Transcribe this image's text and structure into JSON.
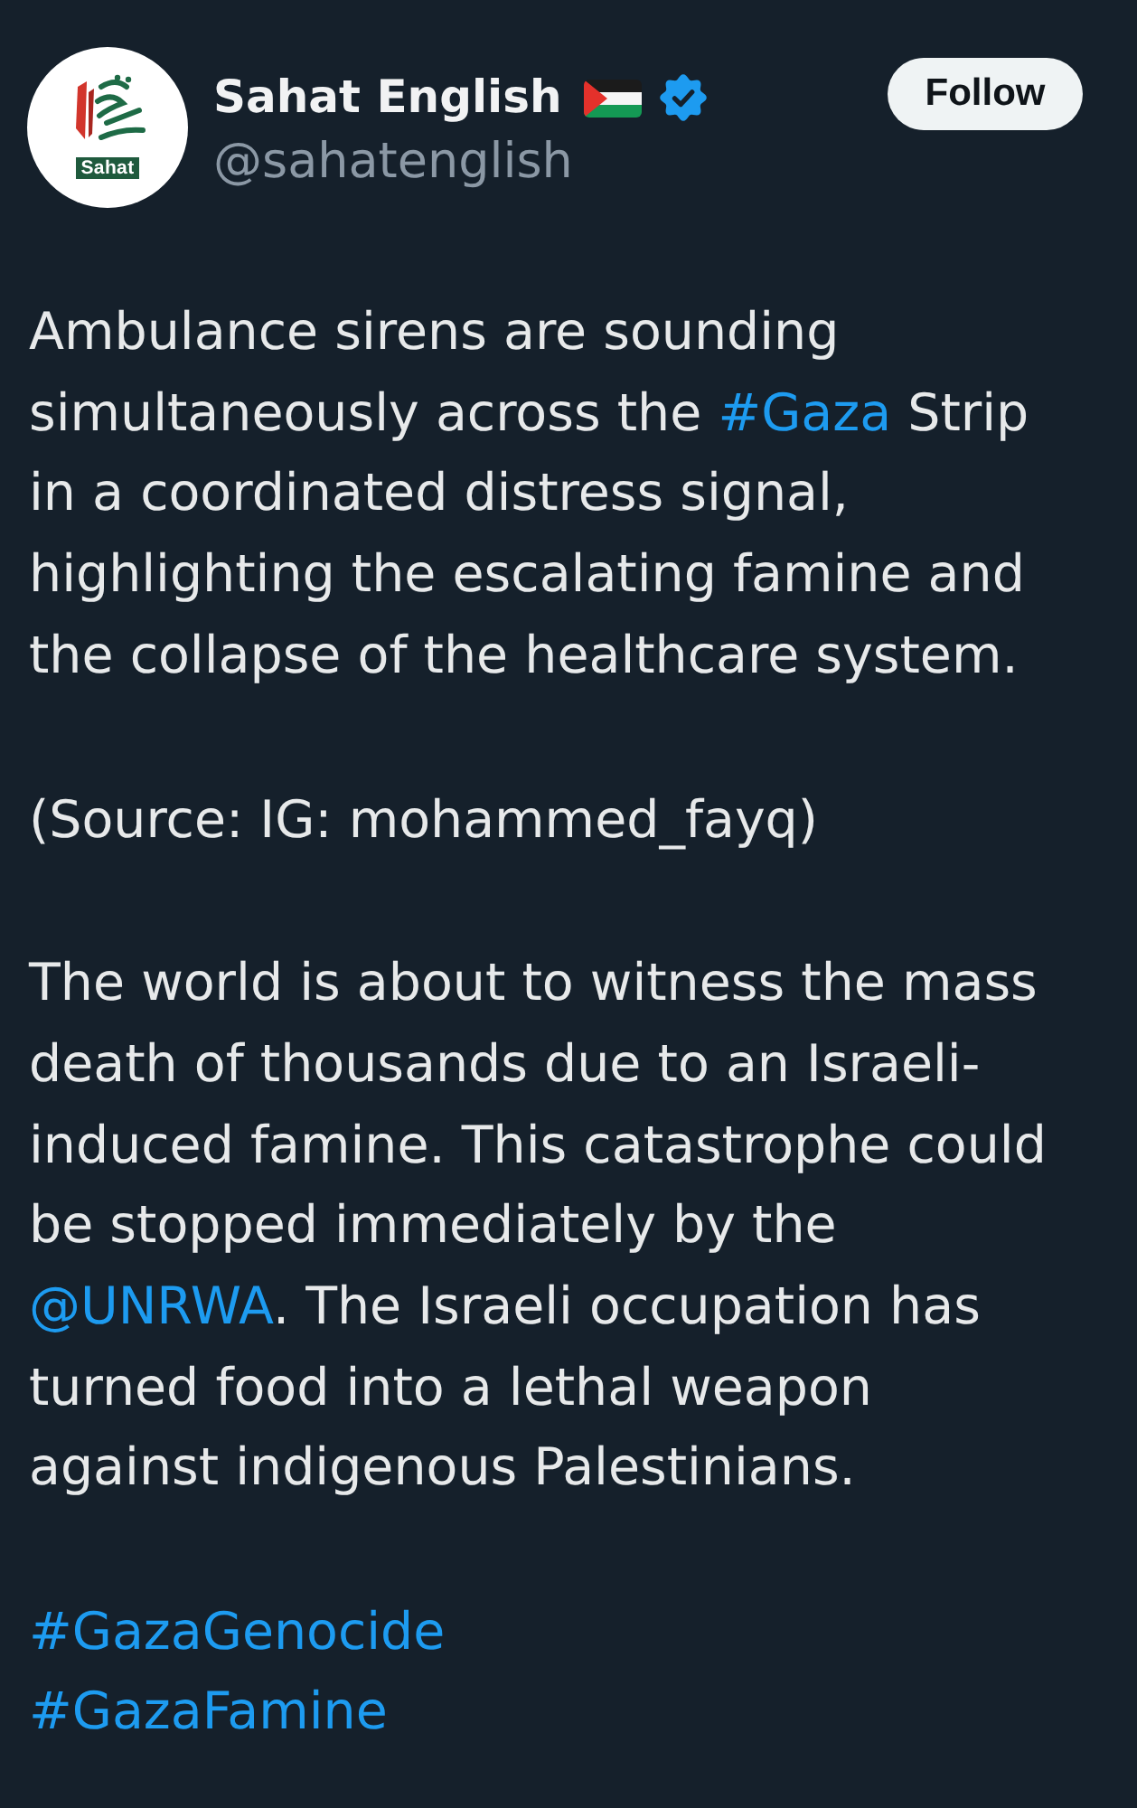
{
  "author": {
    "name": "Sahat English",
    "handle": "@sahatenglish",
    "verified": true,
    "avatar_text": "Sahat"
  },
  "follow_button": {
    "label": "Follow"
  },
  "post": {
    "paragraphs": [
      {
        "segments": [
          {
            "kind": "text",
            "text": "Ambulance sirens are sounding simultaneously across the "
          },
          {
            "kind": "hashtag",
            "text": "#Gaza"
          },
          {
            "kind": "text",
            "text": " Strip in a coordinated distress signal, highlighting the escalating famine and the collapse of the healthcare system."
          }
        ]
      },
      {
        "segments": [
          {
            "kind": "text",
            "text": "(Source: IG: mohammed_fayq)"
          }
        ]
      },
      {
        "segments": [
          {
            "kind": "text",
            "text": "The world is about to witness the mass death of thousands due to an Israeli-induced famine. This catastrophe could be stopped immediately by the "
          },
          {
            "kind": "mention",
            "text": "@UNRWA"
          },
          {
            "kind": "text",
            "text": ". The Israeli occupation has turned food into a lethal weapon against indigenous Palestinians."
          }
        ]
      }
    ],
    "hashtags": [
      "#GazaGenocide",
      "#GazaFamine"
    ]
  }
}
